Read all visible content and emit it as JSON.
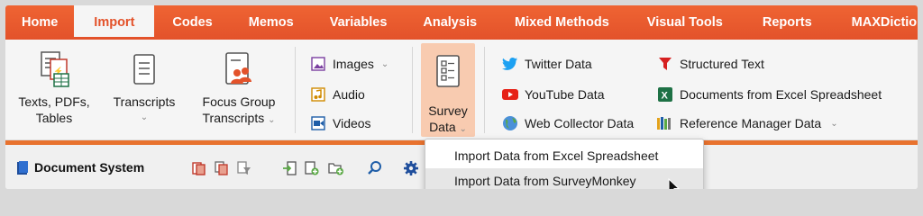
{
  "menu": {
    "items": [
      {
        "label": "Home"
      },
      {
        "label": "Import",
        "active": true
      },
      {
        "label": "Codes"
      },
      {
        "label": "Memos"
      },
      {
        "label": "Variables"
      },
      {
        "label": "Analysis"
      },
      {
        "label": "Mixed Methods"
      },
      {
        "label": "Visual Tools"
      },
      {
        "label": "Reports"
      },
      {
        "label": "MAXDictio"
      }
    ]
  },
  "ribbon": {
    "texts_pdfs_tables": {
      "line1": "Texts, PDFs,",
      "line2": "Tables"
    },
    "transcripts": {
      "label": "Transcripts",
      "caret": "⌄"
    },
    "focus_group": {
      "line1": "Focus Group",
      "line2": "Transcripts",
      "caret": "⌄"
    },
    "images": {
      "label": "Images",
      "caret": "⌄"
    },
    "audio": {
      "label": "Audio"
    },
    "videos": {
      "label": "Videos"
    },
    "survey": {
      "line1": "Survey",
      "line2": "Data",
      "caret": "⌄"
    },
    "twitter": {
      "label": "Twitter Data"
    },
    "youtube": {
      "label": "YouTube Data"
    },
    "web_collector": {
      "label": "Web Collector Data"
    },
    "structured_text": {
      "label": "Structured Text"
    },
    "excel_docs": {
      "label": "Documents from Excel Spreadsheet"
    },
    "reference_manager": {
      "label": "Reference Manager Data",
      "caret": "⌄"
    }
  },
  "document_system": {
    "title": "Document System"
  },
  "dropdown": {
    "items": [
      {
        "label": "Import Data from Excel Spreadsheet"
      },
      {
        "label": "Import Data from SurveyMonkey",
        "hover": true
      }
    ]
  },
  "colors": {
    "accent": "#e3522a",
    "survey_highlight": "#f8cbb0",
    "twitter": "#1da1f2",
    "youtube": "#e62117",
    "excel": "#1e7145"
  }
}
